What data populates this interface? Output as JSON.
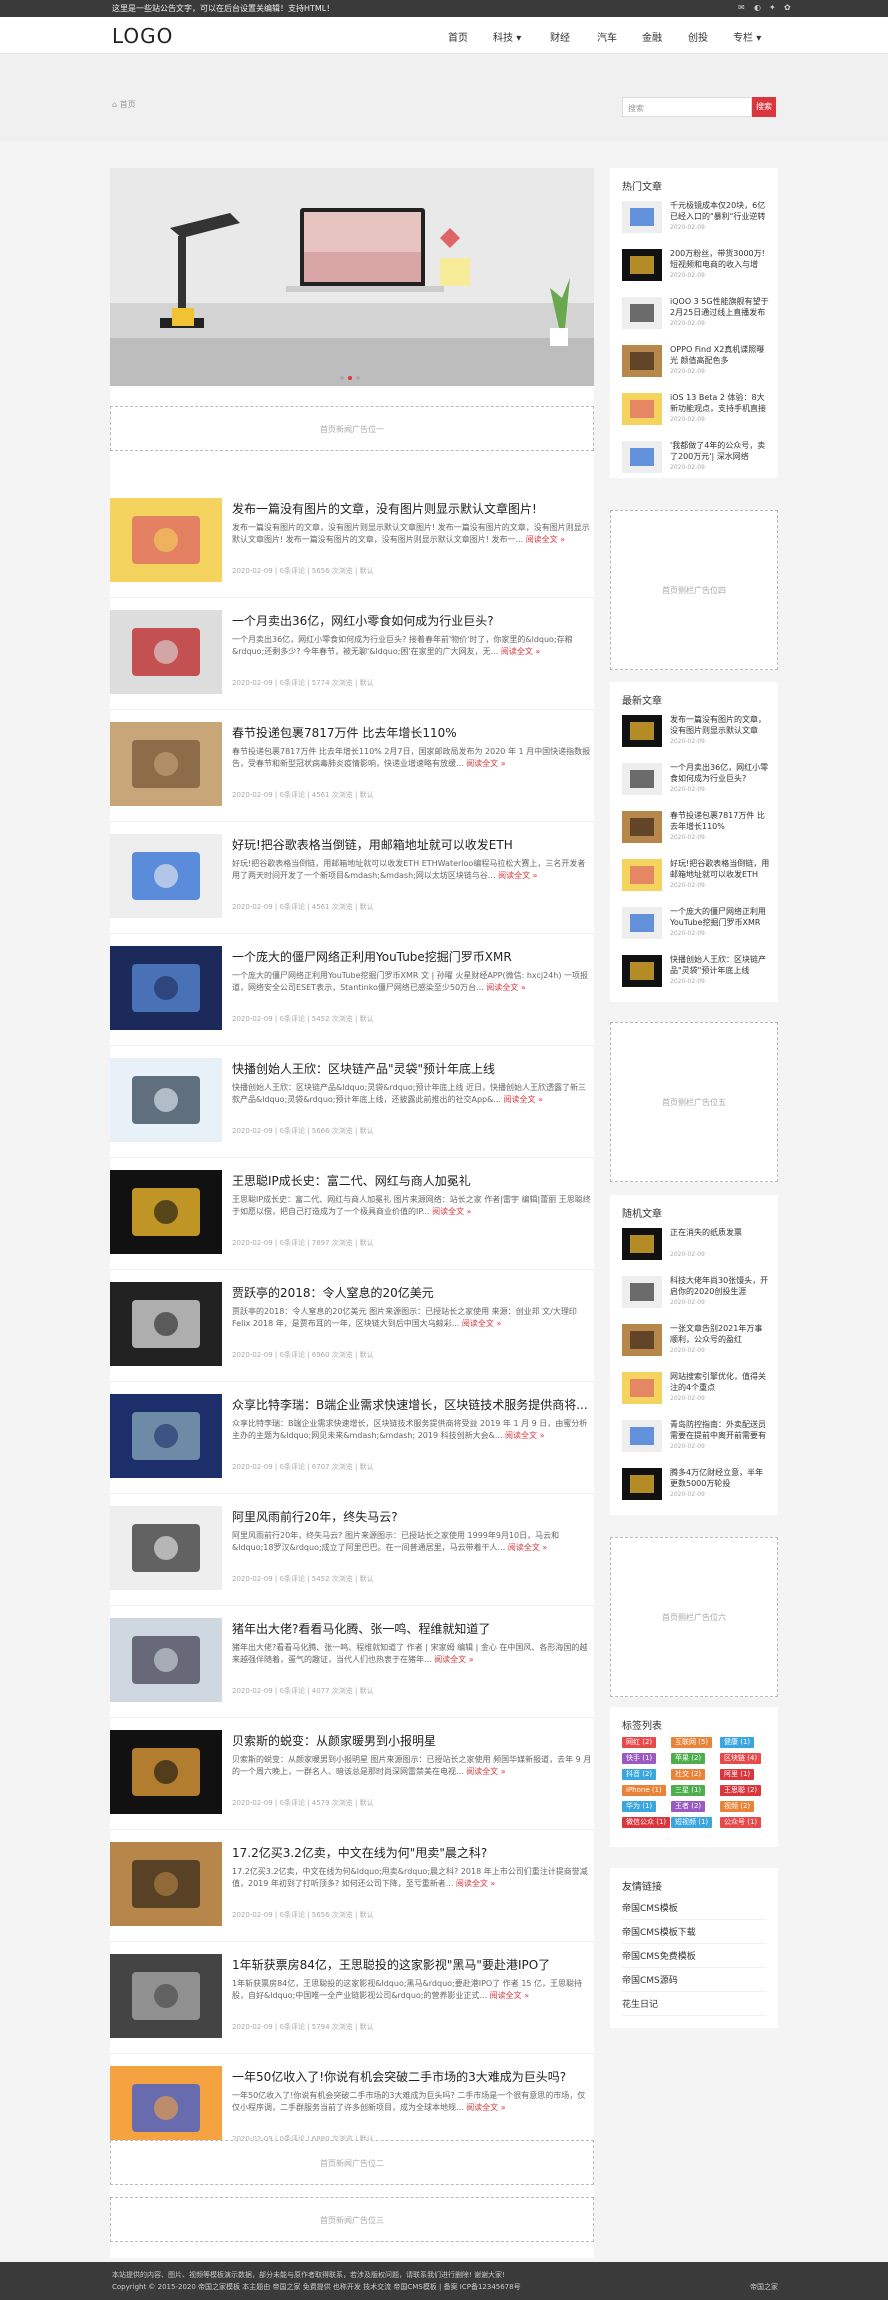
{
  "topbar": {
    "notice": "这里是一些站公告文字，可以在后台设置关编辑！支持HTML！",
    "icons": [
      "qq-icon",
      "person-icon",
      "weibo-icon",
      "wechat-icon"
    ]
  },
  "header": {
    "logo": "LOGO",
    "nav": [
      "首页",
      "科技",
      "财经",
      "汽车",
      "金融",
      "创投",
      "专栏"
    ]
  },
  "crumb": "首页",
  "search": {
    "placeholder": "搜索",
    "button": "搜索"
  },
  "slider": {
    "dots": 3
  },
  "ads": {
    "main_1": "首页新闻广告位一",
    "main_2": "首页新闻广告位二",
    "main_3": "首页新闻广告位三",
    "side_4": "首页侧栏广告位四",
    "side_5": "首页侧栏广告位五",
    "side_6": "首页侧栏广告位六"
  },
  "articles": [
    {
      "title": "发布一篇没有图片的文章，没有图片则显示默认文章图片!",
      "summary": "发布一篇没有图片的文章，没有图片则显示默认文章图片! 发布一篇没有图片的文章，没有图片则显示默认文章图片! 发布一篇没有图片的文章，没有图片则显示默认文章图片! 发布一...",
      "more": "阅读全文",
      "meta": "2020-02-09 | 0条评论 | 5656 次浏览 | 默认"
    },
    {
      "title": "一个月卖出36亿，网红小零食如何成为行业巨头?",
      "summary": "一个月卖出36亿，网红小零食如何成为行业巨头? 接着春年前'物价'时了，你家里的&ldquo;存粮&rdquo;还剩多少? 今年春节，被无聊'&ldquo;困'在家里的广大网友，无...",
      "more": "阅读全文",
      "meta": "2020-02-09 | 0条评论 | 5774 次浏览 | 默认"
    },
    {
      "title": "春节投递包裹7817万件 比去年增长110%",
      "summary": "春节投递包裹7817万件 比去年增长110% 2月7日，国家邮政局发布为 2020 年 1 月中国快递指数报告，受春节和新型冠状病毒肺炎疫情影响，快递业增速略有放缓...",
      "more": "阅读全文",
      "meta": "2020-02-09 | 0条评论 | 4561 次浏览 | 默认"
    },
    {
      "title": "好玩!把谷歌表格当倒链，用邮箱地址就可以收发ETH",
      "summary": "好玩!把谷歌表格当倒链，用邮箱地址就可以收发ETH ETHWaterloo编程马拉松大赛上，三名开发者用了两天时间开发了一个新项目&mdash;&mdash;网以太坊区块链与谷...",
      "more": "阅读全文",
      "meta": "2020-02-09 | 0条评论 | 4561 次浏览 | 默认"
    },
    {
      "title": "一个庞大的僵尸网络正利用YouTube挖掘门罗币XMR",
      "summary": "一个庞大的僵尸网络正利用YouTube挖掘门罗币XMR 文 | 孙曜 火星财经APP(微信: hxcj24h) 一项报道，网络安全公司ESET表示，Stantinko僵尸网络已感染至少50万台...",
      "more": "阅读全文",
      "meta": "2020-02-09 | 0条评论 | 5452 次浏览 | 默认"
    },
    {
      "title": "快播创始人王欣：区块链产品\"灵袋\"预计年底上线",
      "summary": "快播创始人王欣：区块链产品&ldquo;灵袋&rdquo;预计年底上线 近日，快播创始人王欣透露了新三款产品&ldquo;灵袋&rdquo;预计年底上线，还披露此前推出的社交App&...",
      "more": "阅读全文",
      "meta": "2020-02-09 | 0条评论 | 5666 次浏览 | 默认"
    },
    {
      "title": "王思聪IP成长史：富二代、网红与商人加冕礼",
      "summary": "王思聪IP成长史：富二代、网红与商人加冕礼 图片来源网络：站长之家 作者|雷宇 编辑|蕾丽 王思聪终于如愿以偿，把自己打造成为了一个极具商业价值的IP...",
      "more": "阅读全文",
      "meta": "2020-02-09 | 0条评论 | 7897 次浏览 | 默认"
    },
    {
      "title": "贾跃亭的2018：令人窒息的20亿美元",
      "summary": "贾跃亭的2018：令人窒息的20亿美元 图片来源图示：已授站长之家使用 来源：创业邦 文/大理印Felix 2018 年，是贾布耳的一年，区块链大到后中国大乌鲸彩...",
      "more": "阅读全文",
      "meta": "2020-02-09 | 0条评论 | 6960 次浏览 | 默认"
    },
    {
      "title": "众享比特李瑞：B端企业需求快速增长，区块链技术服务提供商将...",
      "summary": "众享比特李瑞：B端企业需求快速增长，区块链技术服务提供商将受益 2019 年 1 月 9 日，由蜜分析主办的主题为&ldquo;网见未来&mdash;&mdash; 2019 科技创新大会&...",
      "more": "阅读全文",
      "meta": "2020-02-09 | 0条评论 | 6707 次浏览 | 默认"
    },
    {
      "title": "阿里风雨前行20年，终失马云?",
      "summary": "阿里风雨前行20年，终失马云? 图片来源图示：已授站长之家使用 1999年9月10日，马云和&ldquo;18罗汉&rdquo;成立了阿里巴巴。在一间普通居里，马云带着干人...",
      "more": "阅读全文",
      "meta": "2020-02-09 | 0条评论 | 5452 次浏览 | 默认"
    },
    {
      "title": "猪年出大佬?看看马化腾、张一鸣、程维就知道了",
      "summary": "猪年出大佬?看看马化腾、张一鸣、程维就知道了 作者 | 宋家姆 编辑 | 金心 在中国风、各形海国的越来越强伴随着，蛋气的趣证，当代人们也热衷于在猪年...",
      "more": "阅读全文",
      "meta": "2020-02-09 | 0条评论 | 4077 次浏览 | 默认"
    },
    {
      "title": "贝索斯的蜕变：从颜家暖男到小报明星",
      "summary": "贝索斯的蜕变：从颜家暖男到小报明星 图片来源图示：已授站长之家使用 频国华媒新报道，去年 9 月的一个周六晚上，一群名人、暗该总是那时尚深网雷禁美在电视...",
      "more": "阅读全文",
      "meta": "2020-02-09 | 0条评论 | 4579 次浏览 | 默认"
    },
    {
      "title": "17.2亿买3.2亿卖，中文在线为何\"甩卖\"晨之科?",
      "summary": "17.2亿买3.2亿卖，中文在线为何&ldquo;甩卖&rdquo;晨之科? 2018 年上市公司们重注计提商誉减值，2019 年初到了打听顶多? 如何还公司下降，至亏重新者...",
      "more": "阅读全文",
      "meta": "2020-02-09 | 0条评论 | 5656 次浏览 | 默认"
    },
    {
      "title": "1年斩获票房84亿，王思聪投的这家影视\"黑马\"要赴港IPO了",
      "summary": "1年斩获票房84亿，王思聪投的这家影视&ldquo;黑马&rdquo;要赴港IPO了 作者 15 亿，王思聪持股，自好&ldquo;中国唯一全产业链影视公司&rdquo;的营养影业正式...",
      "more": "阅读全文",
      "meta": "2020-02-09 | 0条评论 | 5794 次浏览 | 默认"
    },
    {
      "title": "一年50亿收入了!你说有机会突破二手市场的3大难成为巨头吗?",
      "summary": "一年50亿收入了!你说有机会突破二手市场的3大难成为巨头吗? 二手市场是一个很有意思的市场，仅仅小程序调，二手群服务当前了许多创新项目，成为全球本地规...",
      "more": "阅读全文",
      "meta": "2020-02-09 | 0条评论 | 6880 次浏览 | 默认"
    }
  ],
  "hot": {
    "title": "热门文章",
    "items": [
      {
        "t": "千元极镜成本仅20块，6亿已经入口的\"暴利\"行业逆转",
        "d": "2020-02-09"
      },
      {
        "t": "200万粉丝，带货3000万!短视频和电商的收入与增",
        "d": "2020-02-09"
      },
      {
        "t": "iQOO 3 5G性能旗舰有望于2月25日通过线上直播发布",
        "d": "2020-02-09"
      },
      {
        "t": "OPPO Find X2真机谍照曝光 颜值高配色多",
        "d": "2020-02-09"
      },
      {
        "t": "iOS 13 Beta 2 体验：8大新功能观点，支持手机直接开",
        "d": "2020-02-09"
      },
      {
        "t": "'我都做了4年的公众号，卖了200万元'| 深水网络",
        "d": "2020-02-09"
      }
    ]
  },
  "latest": {
    "title": "最新文章",
    "items": [
      {
        "t": "发布一篇没有图片的文章，没有图片则显示默认文章",
        "d": "2020-02-09"
      },
      {
        "t": "一个月卖出36亿，网红小零食如何成为行业巨头?",
        "d": "2020-02-09"
      },
      {
        "t": "春节投递包裹7817万件 比去年增长110%",
        "d": "2020-02-09"
      },
      {
        "t": "好玩!把谷歌表格当倒链，用邮箱地址就可以收发ETH",
        "d": "2020-02-09"
      },
      {
        "t": "一个庞大的僵尸网络正利用YouTube挖掘门罗币XMR",
        "d": "2020-02-09"
      },
      {
        "t": "快播创始人王欣：区块链产品\"灵袋\"预计年底上线",
        "d": "2020-02-09"
      }
    ]
  },
  "random": {
    "title": "随机文章",
    "items": [
      {
        "t": "正在消失的纸质发票",
        "d": "2020-02-09"
      },
      {
        "t": "科技大佬年尚30张馒头，开启你的2020创投生涯",
        "d": "2020-02-09"
      },
      {
        "t": "一张文章告别2021年万事顺利，公众号的盈红",
        "d": "2020-02-09"
      },
      {
        "t": "网站搜索引擎优化，值得关注的4个重点",
        "d": "2020-02-09"
      },
      {
        "t": "青岛防控指南：外卖配送员需要在提前中离开前需要有",
        "d": "2020-02-09"
      },
      {
        "t": "腾多4万亿财经立意，半年更数5000万轮投",
        "d": "2020-02-09"
      }
    ]
  },
  "tags": {
    "title": "标签列表",
    "items": [
      {
        "label": "网红 (2)",
        "color": "#e64b4b"
      },
      {
        "label": "互联网 (5)",
        "color": "#e8833a"
      },
      {
        "label": "健康 (1)",
        "color": "#3aa6dd"
      },
      {
        "label": "快手 (1)",
        "color": "#9a5bc1"
      },
      {
        "label": "苹果 (2)",
        "color": "#4cae4c"
      },
      {
        "label": "区块链 (4)",
        "color": "#e64b4b"
      },
      {
        "label": "抖音 (2)",
        "color": "#3aa6dd"
      },
      {
        "label": "社交 (2)",
        "color": "#e8833a"
      },
      {
        "label": "阿里 (1)",
        "color": "#d9363e"
      },
      {
        "label": "iPhone (1)",
        "color": "#e8833a"
      },
      {
        "label": "三星 (1)",
        "color": "#4cae4c"
      },
      {
        "label": "王思聪 (2)",
        "color": "#d9363e"
      },
      {
        "label": "华为 (1)",
        "color": "#3aa6dd"
      },
      {
        "label": "王者 (2)",
        "color": "#9a5bc1"
      },
      {
        "label": "视频 (2)",
        "color": "#e8833a"
      },
      {
        "label": "微信公众 (1)",
        "color": "#d9363e"
      },
      {
        "label": "短视频 (1)",
        "color": "#3aa6dd"
      },
      {
        "label": "公众号 (1)",
        "color": "#e64b4b"
      }
    ]
  },
  "links": {
    "title": "友情链接",
    "items": [
      "帝国CMS模板",
      "帝国CMS模板下载",
      "帝国CMS免费模板",
      "帝国CMS源码",
      "花生日记"
    ]
  },
  "footer": {
    "line1": "本站提供的内容、图片、视频等模板演示数据，部分未能与原作者取得联系，若涉及版权问题，请联系我们进行删除! 谢谢大家!",
    "line2": "Copyright © 2015-2020 帝国之家模板 本主题由 帝国之家 免费提供 也称开发 技术交流 帝国CMS模板 | 备案 ICP备12345678号",
    "right": "帝国之家"
  }
}
